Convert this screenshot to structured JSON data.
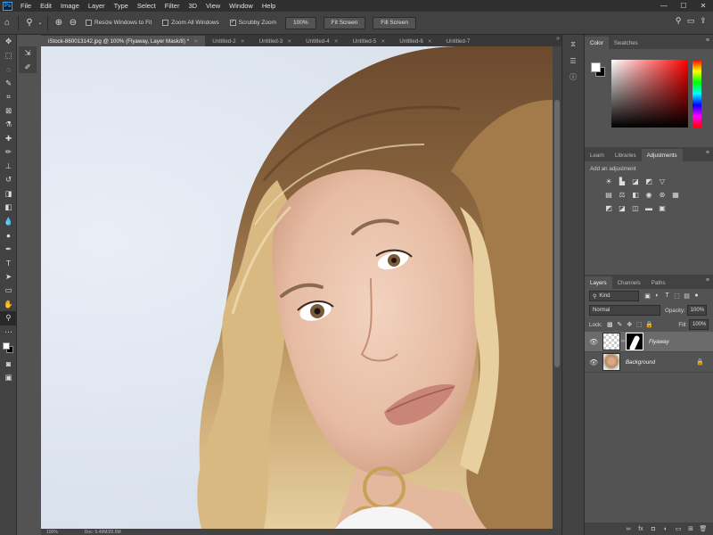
{
  "menubar": {
    "logo": "Ps",
    "items": [
      "File",
      "Edit",
      "Image",
      "Layer",
      "Type",
      "Select",
      "Filter",
      "3D",
      "View",
      "Window",
      "Help"
    ],
    "window_controls": [
      "—",
      "☐",
      "✕"
    ]
  },
  "options": {
    "resize_windows": "Resize Windows to Fit",
    "zoom_all": "Zoom All Windows",
    "scrubby_zoom": "Scrubby Zoom",
    "zoom_value": "100%",
    "fit_screen": "Fit Screen",
    "fill_screen": "Fill Screen"
  },
  "tabs": [
    {
      "label": "iStock-860013142.jpg @ 100% (Flyaway, Layer Mask/8) *",
      "active": true
    },
    {
      "label": "Untitled-2",
      "active": false
    },
    {
      "label": "Untitled-3",
      "active": false
    },
    {
      "label": "Untitled-4",
      "active": false
    },
    {
      "label": "Untitled-5",
      "active": false
    },
    {
      "label": "Untitled-6",
      "active": false
    },
    {
      "label": "Untitled-7",
      "active": false
    }
  ],
  "status": {
    "zoom": "100%",
    "doc": "Doc: 5.49M/20.5M"
  },
  "color_panel": {
    "tabs": [
      "Color",
      "Swatches"
    ]
  },
  "adjustments_panel": {
    "tabs": [
      "Learn",
      "Libraries",
      "Adjustments"
    ],
    "title": "Add an adjustment"
  },
  "layers_panel": {
    "tabs": [
      "Layers",
      "Channels",
      "Paths"
    ],
    "filter_kind": "Kind",
    "blend_mode": "Normal",
    "opacity_label": "Opacity:",
    "opacity_value": "100%",
    "lock_label": "Lock:",
    "fill_label": "Fill:",
    "fill_value": "100%",
    "layers": [
      {
        "name": "Flyaway",
        "selected": true
      },
      {
        "name": "Background",
        "selected": false
      }
    ]
  }
}
